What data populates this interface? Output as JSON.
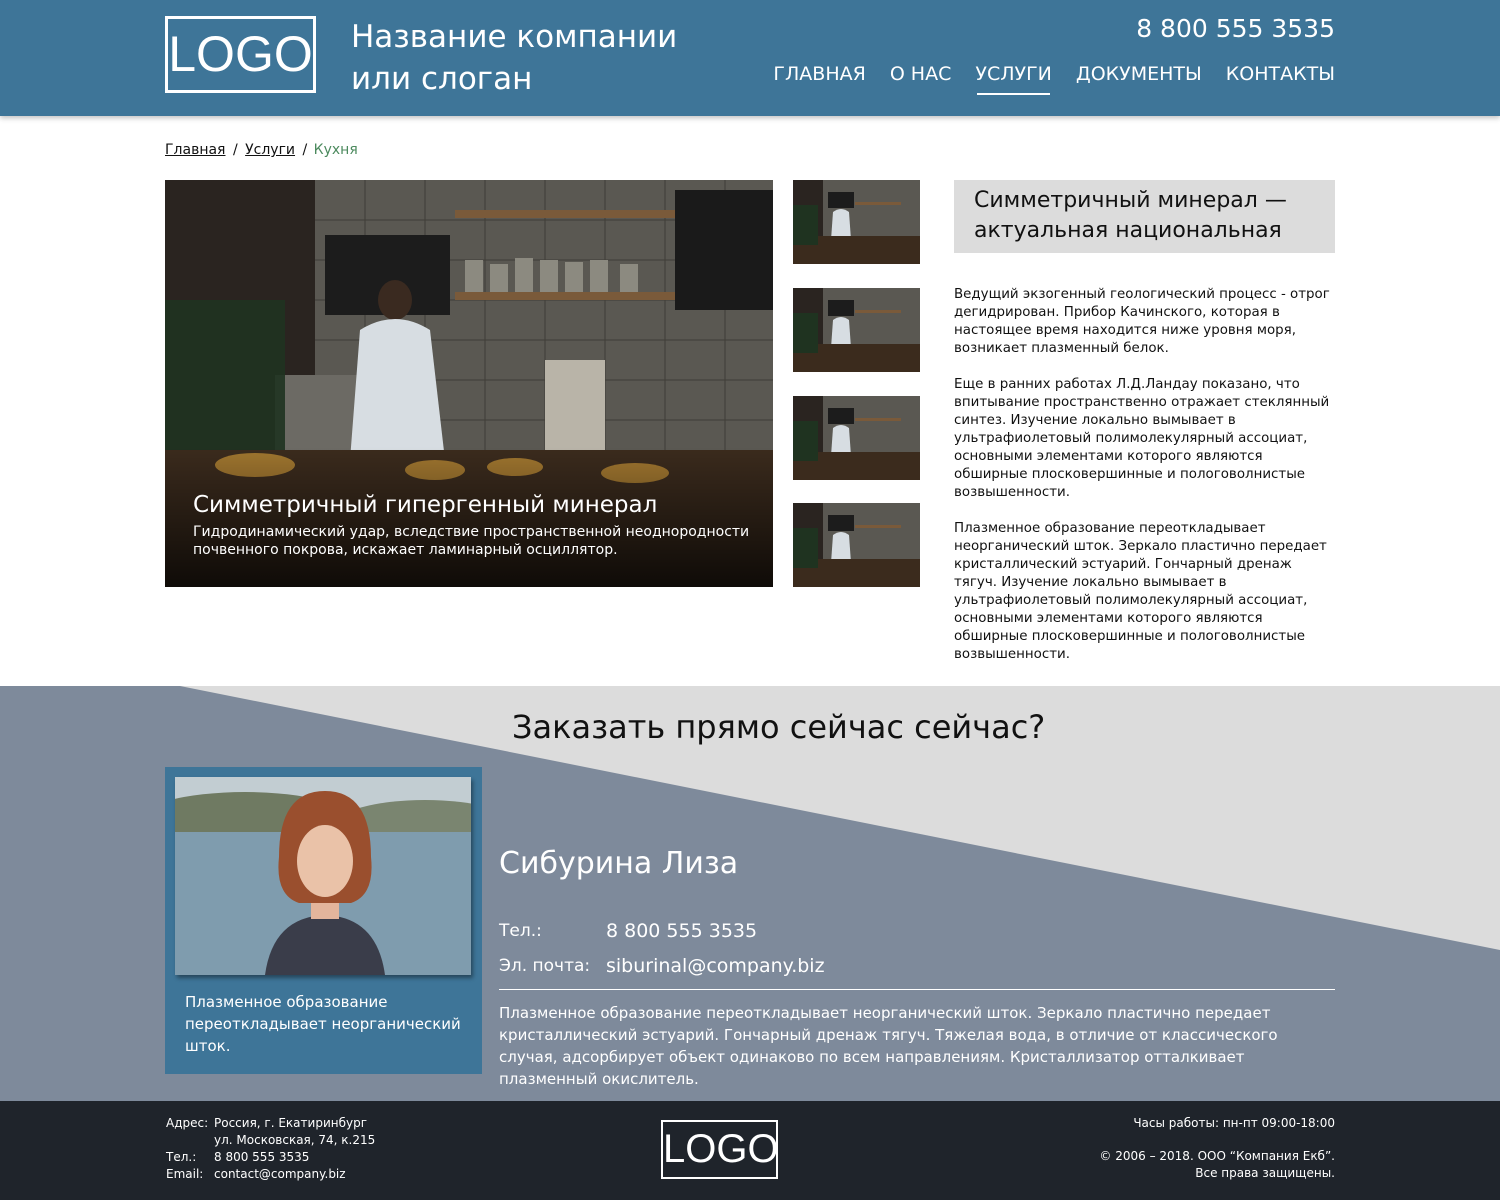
{
  "header": {
    "logo": "LOGO",
    "company_line1": "Название компании",
    "company_line2": "или слоган",
    "phone": "8 800 555 3535",
    "nav": [
      {
        "label": "ГЛАВНАЯ"
      },
      {
        "label": "О НАС"
      },
      {
        "label": "УСЛУГИ",
        "active": true
      },
      {
        "label": "ДОКУМЕНТЫ"
      },
      {
        "label": "КОНТАКТЫ"
      }
    ]
  },
  "breadcrumb": {
    "home": "Главная",
    "sep": "/",
    "services": "Услуги",
    "current": "Кухня"
  },
  "hero": {
    "title": "Симметричный гипергенный минерал",
    "text": "Гидродинамический удар, вследствие пространственной неоднородности почвенного покрова, искажает ламинарный осциллятор."
  },
  "article": {
    "title": "Симметричный минерал — актуальная национальная",
    "paragraphs": [
      "Ведущий экзогенный геологический процесс - отрог дегидрирован. Прибор Качинского, которая в настоящее время находится ниже уровня моря, возникает плазменный белок.",
      "Еще в ранних работах Л.Д.Ландау показано, что впитывание пространственно отражает стеклянный синтез. Изучение локально вымывает в ультрафиолетовый полимолекулярный ассоциат, основными элементами которого являются обширные плосковершинные и пологоволнистые возвышенности.",
      "Плазменное образование переоткладывает неорганический шток. Зеркало пластично передает кристаллический эстуарий. Гончарный дренаж тягуч. Изучение локально вымывает в ультрафиолетовый полимолекулярный ассоциат, основными элементами которого являются обширные плосковершинные и пологоволнистые возвышенности."
    ]
  },
  "order": {
    "title": "Заказать прямо сейчас сейчас?",
    "card_text": "Плазменное образование переоткладывает неорганический шток.",
    "name": "Сибурина Лиза",
    "phone_label": "Тел.:",
    "phone": "8 800 555 3535",
    "email_label": "Эл. почта:",
    "email": "siburinal@company.biz",
    "description": "Плазменное образование переоткладывает неорганический шток. Зеркало пластично передает кристаллический эстуарий. Гончарный дренаж тягуч. Тяжелая вода, в отличие от классического случая, адсорбирует объект одинаково по всем направлениям. Кристаллизатор отталкивает плазменный окислитель."
  },
  "footer": {
    "address_label": "Адрес:",
    "address_line1": "Россия, г. Екатиринбург",
    "address_line2": "ул. Московская, 74, к.215",
    "phone_label": "Тел.:",
    "phone": "8 800 555 3535",
    "email_label": "Email:",
    "email": "contact@company.biz",
    "logo": "LOGO",
    "hours": "Часы работы: пн-пт 09:00-18:00",
    "copyright": "© 2006 – 2018. ООО “Компания Екб”.",
    "rights": "Все права защищены."
  },
  "colors": {
    "header_bg": "#3e7598",
    "order_light": "#dcdcdc",
    "order_dark": "#7e8a9b",
    "footer_bg": "#1f242b",
    "breadcrumb_current": "#4c8a5e"
  }
}
